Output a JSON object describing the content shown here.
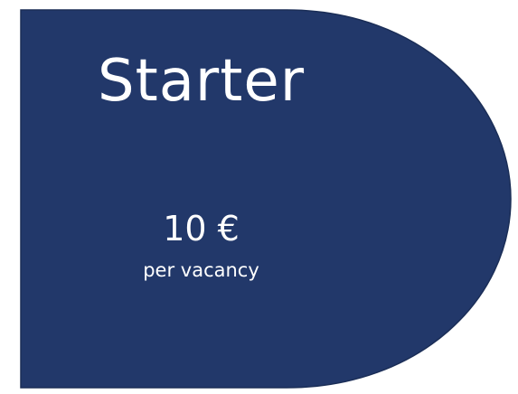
{
  "plan": {
    "title": "Starter",
    "price": "10 €",
    "unit": "per vacancy"
  },
  "colors": {
    "card_fill": "#22386a",
    "card_stroke": "#1b2e57",
    "text": "#ffffff",
    "background": "#ffffff"
  }
}
